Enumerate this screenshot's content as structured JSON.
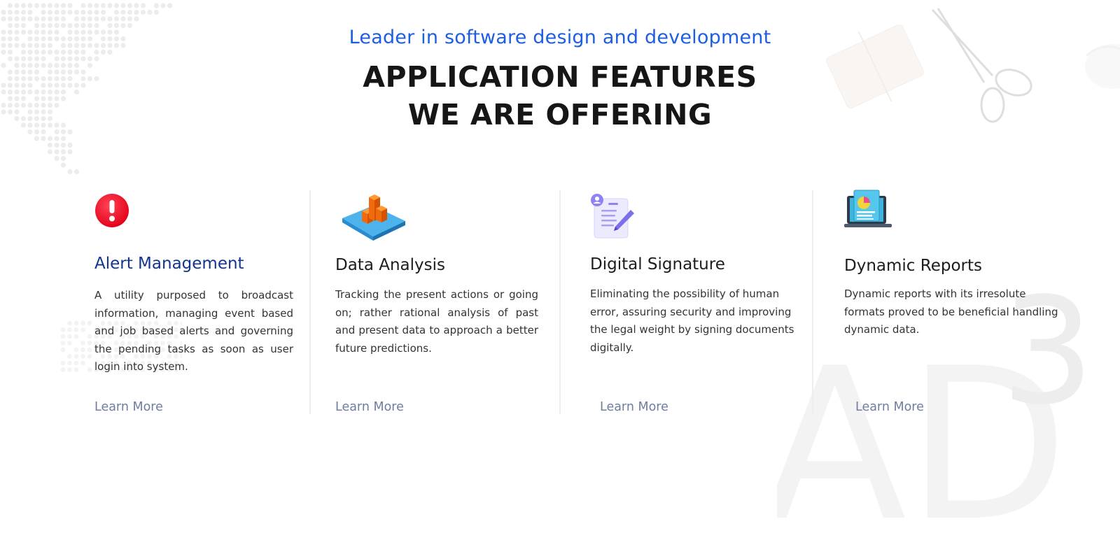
{
  "header": {
    "eyebrow": "Leader in software design and development",
    "headline_line1": "APPLICATION FEATURES",
    "headline_line2": "WE ARE OFFERING"
  },
  "watermark": "AD",
  "watermark_superscript": "3",
  "colors": {
    "eyebrow": "#1d5fe0",
    "headline": "#161616",
    "active_title": "#12358f",
    "link": "#6f7e9f"
  },
  "features": [
    {
      "icon": "alert-icon",
      "title": "Alert Management",
      "description": "A utility purposed to broadcast information, managing event based and job based alerts and governing the pending tasks as soon as user login into system.",
      "link": "Learn More"
    },
    {
      "icon": "data-analysis-icon",
      "title": "Data Analysis",
      "description": "Tracking the present actions or going on; rather rational analysis of past and present data to approach a better future predictions.",
      "link": "Learn More"
    },
    {
      "icon": "digital-signature-icon",
      "title": "Digital Signature",
      "description": "Eliminating the possibility of human error, assuring security and improving the legal weight by signing documents digitally.",
      "link": "Learn More"
    },
    {
      "icon": "dynamic-reports-icon",
      "title": "Dynamic Reports",
      "description": "Dynamic reports with its irresolute formats proved to be beneficial handling dynamic data.",
      "link": "Learn More"
    }
  ]
}
